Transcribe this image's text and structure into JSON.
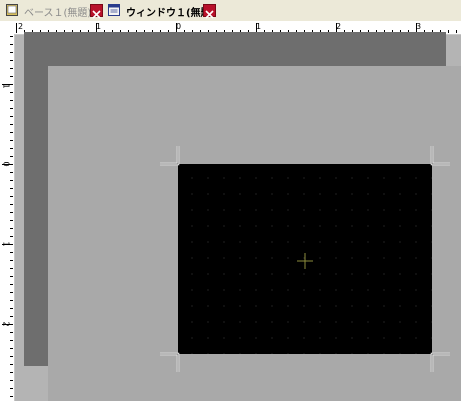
{
  "tabs": [
    {
      "label": "ベース１(無題)",
      "icon": "base-screen-icon",
      "active": false
    },
    {
      "label": "ウィンドウ１(無題)",
      "icon": "window-screen-icon",
      "active": true
    }
  ],
  "ruler": {
    "top_labels": [
      "2",
      "1",
      "0",
      "1",
      "2",
      "3"
    ],
    "left_labels": [
      "1",
      "0",
      "1",
      "2"
    ]
  },
  "colors": {
    "tab_close": "#b8112a",
    "canvas_window": "#000000",
    "canvas_base": "#a9a9a9",
    "workspace": "#b4b4b4",
    "crosshair": "#8c8c3c"
  }
}
